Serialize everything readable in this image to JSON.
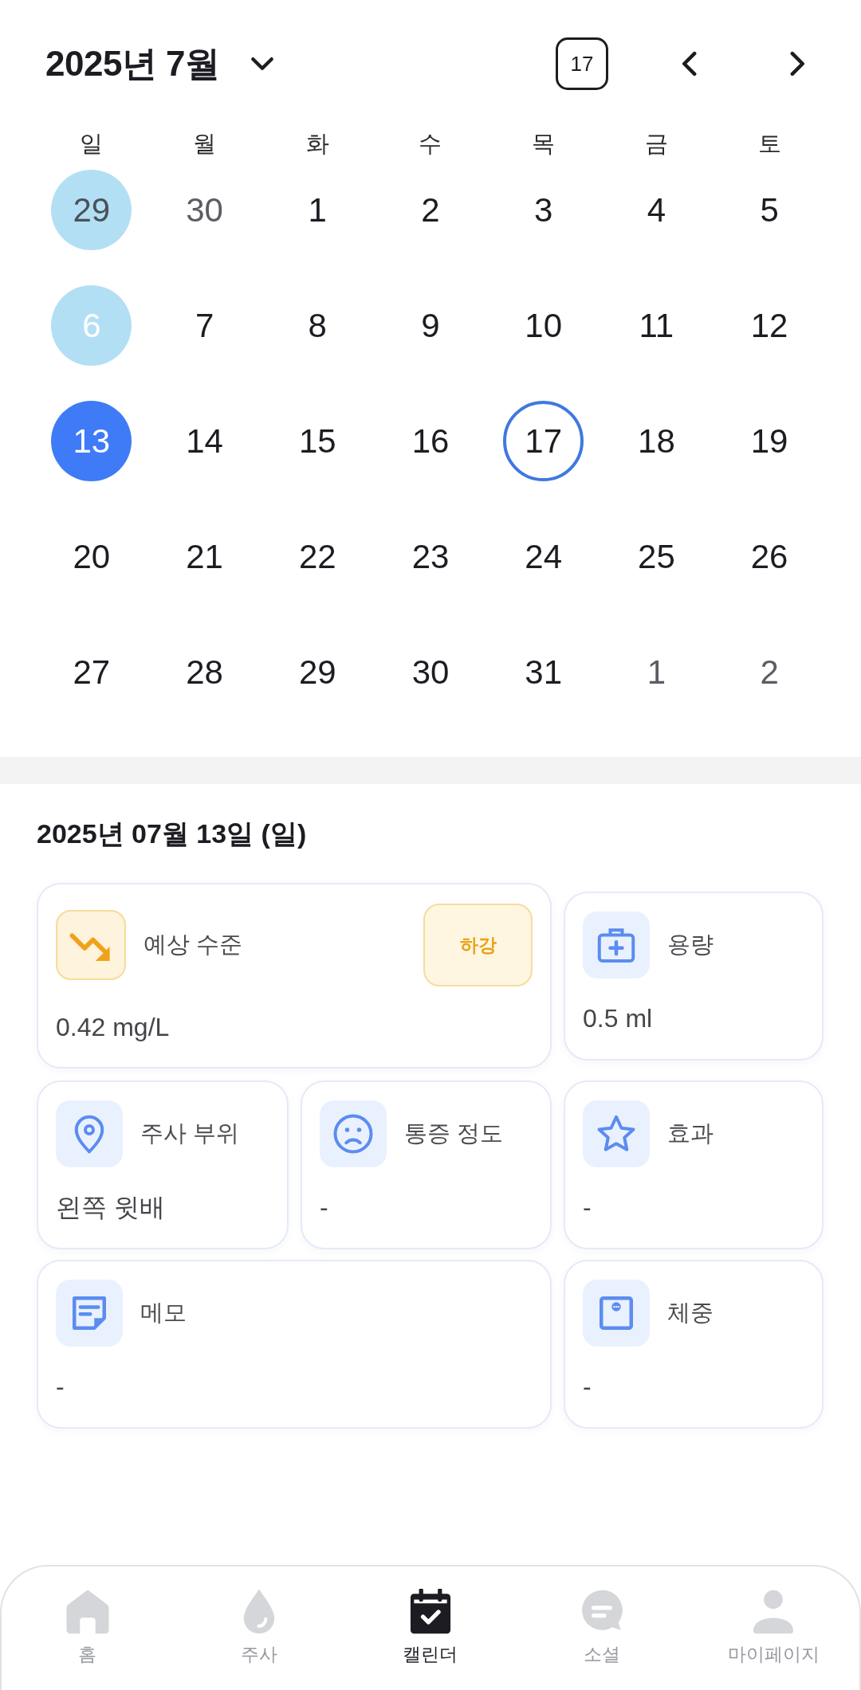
{
  "header": {
    "title": "2025년 7월",
    "today_button": "17"
  },
  "calendar": {
    "weekdays": [
      "일",
      "월",
      "화",
      "수",
      "목",
      "금",
      "토"
    ],
    "weeks": [
      {
        "days": [
          {
            "label": "29",
            "outside": true,
            "marked": true,
            "selected": false,
            "today": false
          },
          {
            "label": "30",
            "outside": true,
            "marked": false,
            "selected": false,
            "today": false
          },
          {
            "label": "1",
            "outside": false,
            "marked": false,
            "selected": false,
            "today": false
          },
          {
            "label": "2",
            "outside": false,
            "marked": false,
            "selected": false,
            "today": false
          },
          {
            "label": "3",
            "outside": false,
            "marked": false,
            "selected": false,
            "today": false
          },
          {
            "label": "4",
            "outside": false,
            "marked": false,
            "selected": false,
            "today": false
          },
          {
            "label": "5",
            "outside": false,
            "marked": false,
            "selected": false,
            "today": false
          }
        ]
      },
      {
        "days": [
          {
            "label": "6",
            "outside": false,
            "marked": true,
            "selected": false,
            "today": false
          },
          {
            "label": "7",
            "outside": false,
            "marked": false,
            "selected": false,
            "today": false
          },
          {
            "label": "8",
            "outside": false,
            "marked": false,
            "selected": false,
            "today": false
          },
          {
            "label": "9",
            "outside": false,
            "marked": false,
            "selected": false,
            "today": false
          },
          {
            "label": "10",
            "outside": false,
            "marked": false,
            "selected": false,
            "today": false
          },
          {
            "label": "11",
            "outside": false,
            "marked": false,
            "selected": false,
            "today": false
          },
          {
            "label": "12",
            "outside": false,
            "marked": false,
            "selected": false,
            "today": false
          }
        ]
      },
      {
        "days": [
          {
            "label": "13",
            "outside": false,
            "marked": false,
            "selected": true,
            "today": false
          },
          {
            "label": "14",
            "outside": false,
            "marked": false,
            "selected": false,
            "today": false
          },
          {
            "label": "15",
            "outside": false,
            "marked": false,
            "selected": false,
            "today": false
          },
          {
            "label": "16",
            "outside": false,
            "marked": false,
            "selected": false,
            "today": false
          },
          {
            "label": "17",
            "outside": false,
            "marked": false,
            "selected": false,
            "today": true
          },
          {
            "label": "18",
            "outside": false,
            "marked": false,
            "selected": false,
            "today": false
          },
          {
            "label": "19",
            "outside": false,
            "marked": false,
            "selected": false,
            "today": false
          }
        ]
      },
      {
        "days": [
          {
            "label": "20",
            "outside": false,
            "marked": false,
            "selected": false,
            "today": false
          },
          {
            "label": "21",
            "outside": false,
            "marked": false,
            "selected": false,
            "today": false
          },
          {
            "label": "22",
            "outside": false,
            "marked": false,
            "selected": false,
            "today": false
          },
          {
            "label": "23",
            "outside": false,
            "marked": false,
            "selected": false,
            "today": false
          },
          {
            "label": "24",
            "outside": false,
            "marked": false,
            "selected": false,
            "today": false
          },
          {
            "label": "25",
            "outside": false,
            "marked": false,
            "selected": false,
            "today": false
          },
          {
            "label": "26",
            "outside": false,
            "marked": false,
            "selected": false,
            "today": false
          }
        ]
      },
      {
        "days": [
          {
            "label": "27",
            "outside": false,
            "marked": false,
            "selected": false,
            "today": false
          },
          {
            "label": "28",
            "outside": false,
            "marked": false,
            "selected": false,
            "today": false
          },
          {
            "label": "29",
            "outside": false,
            "marked": false,
            "selected": false,
            "today": false
          },
          {
            "label": "30",
            "outside": false,
            "marked": false,
            "selected": false,
            "today": false
          },
          {
            "label": "31",
            "outside": false,
            "marked": false,
            "selected": false,
            "today": false
          },
          {
            "label": "1",
            "outside": true,
            "marked": false,
            "selected": false,
            "today": false
          },
          {
            "label": "2",
            "outside": true,
            "marked": false,
            "selected": false,
            "today": false
          }
        ]
      }
    ]
  },
  "detail": {
    "date": "2025년 07월 13일 (일)",
    "cards": [
      {
        "kind": "trend",
        "label": "예상 수준",
        "value": "0.42 mg/L",
        "badge": "하강"
      },
      {
        "kind": "metric",
        "label": "용량",
        "value": "0.5 ml"
      },
      {
        "kind": "metric",
        "label": "주사 부위",
        "value": "왼쪽 윗배"
      },
      {
        "kind": "metric",
        "label": "통증 정도",
        "value": "-"
      },
      {
        "kind": "metric",
        "label": "효과",
        "value": "-"
      },
      {
        "kind": "metric",
        "label": "메모",
        "value": "-"
      },
      {
        "kind": "metric",
        "label": "체중",
        "value": "-"
      }
    ]
  },
  "nav": [
    {
      "label": "홈",
      "selected": false
    },
    {
      "label": "주사",
      "selected": false
    },
    {
      "label": "캘린더",
      "selected": true
    },
    {
      "label": "소셜",
      "selected": false
    },
    {
      "label": "마이페이지",
      "selected": false
    }
  ]
}
